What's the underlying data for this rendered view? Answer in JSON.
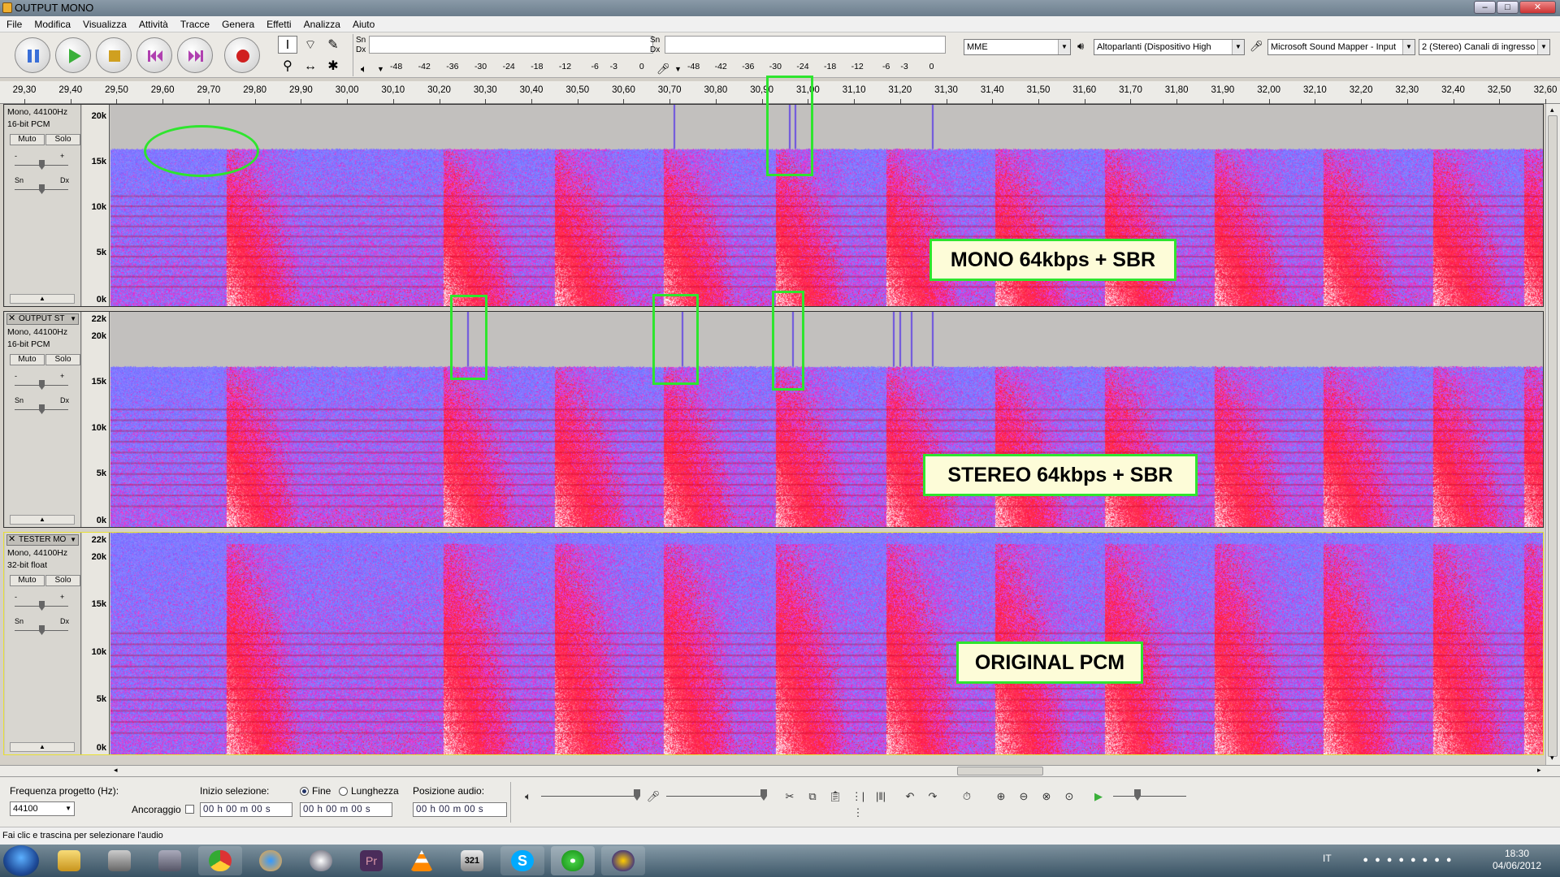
{
  "window": {
    "title": "OUTPUT MONO",
    "min": "–",
    "max": "□",
    "close": "✕"
  },
  "menu": [
    "File",
    "Modifica",
    "Visualizza",
    "Attività",
    "Tracce",
    "Genera",
    "Effetti",
    "Analizza",
    "Aiuto"
  ],
  "meters": {
    "left_top": "Sn",
    "left_bottom": "Dx",
    "right_top": "Sn",
    "right_bottom": "Dx",
    "scale": [
      "-48",
      "-42",
      "-36",
      "-30",
      "-24",
      "-18",
      "-12",
      "-6",
      "-3",
      "0"
    ]
  },
  "devices": {
    "host": "MME",
    "output": "Altoparlanti (Dispositivo High",
    "input": "Microsoft Sound Mapper - Input",
    "channels": "2 (Stereo) Canali di ingresso"
  },
  "ruler": [
    "29,30",
    "29,40",
    "29,50",
    "29,60",
    "29,70",
    "29,80",
    "29,90",
    "30,00",
    "30,10",
    "30,20",
    "30,30",
    "30,40",
    "30,50",
    "30,60",
    "30,70",
    "30,80",
    "30,90",
    "31,00",
    "31,10",
    "31,20",
    "31,30",
    "31,40",
    "31,50",
    "31,60",
    "31,70",
    "31,80",
    "31,90",
    "32,00",
    "32,10",
    "32,20",
    "32,30",
    "32,40",
    "32,50",
    "32,60"
  ],
  "tracks": [
    {
      "name": "",
      "rate": "Mono, 44100Hz",
      "format": "16-bit PCM",
      "mute": "Muto",
      "solo": "Solo",
      "pan_l": "Sn",
      "pan_r": "Dx",
      "gain_minus": "-",
      "gain_plus": "+",
      "scale": [
        "20k",
        "15k",
        "10k",
        "5k",
        "0k"
      ],
      "label": "MONO 64kbps + SBR",
      "type": "mono"
    },
    {
      "name": "OUTPUT ST",
      "rate": "Mono, 44100Hz",
      "format": "16-bit PCM",
      "mute": "Muto",
      "solo": "Solo",
      "pan_l": "Sn",
      "pan_r": "Dx",
      "gain_minus": "-",
      "gain_plus": "+",
      "scale": [
        "22k",
        "20k",
        "15k",
        "10k",
        "5k",
        "0k"
      ],
      "label": "STEREO 64kbps + SBR",
      "type": "stereo"
    },
    {
      "name": "TESTER MO",
      "rate": "Mono, 44100Hz",
      "format": "32-bit float",
      "mute": "Muto",
      "solo": "Solo",
      "pan_l": "Sn",
      "pan_r": "Dx",
      "gain_minus": "-",
      "gain_plus": "+",
      "scale": [
        "22k",
        "20k",
        "15k",
        "10k",
        "5k",
        "0k"
      ],
      "label": "ORIGINAL PCM",
      "type": "pcm"
    }
  ],
  "selection": {
    "rate_label": "Frequenza progetto (Hz):",
    "rate_value": "44100",
    "snap_label": "Ancoraggio",
    "start_label": "Inizio selezione:",
    "end_label": "Fine",
    "length_label": "Lunghezza",
    "pos_label": "Posizione audio:",
    "tc1": "00 h 00 m 00 s",
    "tc2": "00 h 00 m 00 s",
    "tc3": "00 h 00 m 00 s"
  },
  "status": "Fai clic e trascina per selezionare l'audio",
  "taskbar": {
    "lang": "IT",
    "time": "18:30",
    "date": "04/06/2012",
    "premiere": "Pr",
    "imgburn": "321"
  },
  "colors": {
    "green": "#2ee52e",
    "spec_red": "#ff1a3c",
    "spec_blue": "#5a7cff",
    "spec_gray": "#c3c1bf"
  }
}
